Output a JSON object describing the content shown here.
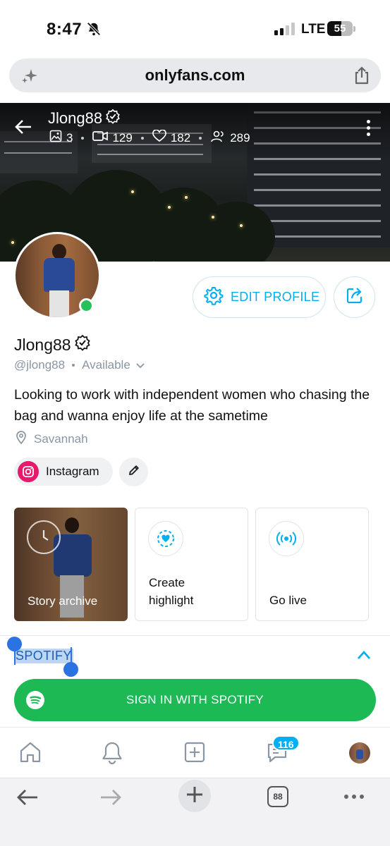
{
  "status_bar": {
    "time": "8:47",
    "network": "LTE",
    "battery": "55"
  },
  "browser": {
    "url": "onlyfans.com",
    "tabs_count": "88"
  },
  "cover": {
    "name": "Jlong88",
    "stats": {
      "photos": "3",
      "videos": "129",
      "likes": "182",
      "fans": "289"
    }
  },
  "profile": {
    "name": "Jlong88",
    "handle": "@jlong88",
    "availability": "Available",
    "bio": "Looking to work with independent women who chasing the bag and wanna enjoy life at the sametime",
    "location": "Savannah",
    "edit_label": "EDIT PROFILE",
    "online": true
  },
  "social": {
    "instagram_label": "Instagram"
  },
  "highlights": [
    {
      "label": "Story archive"
    },
    {
      "label": "Create highlight"
    },
    {
      "label": "Go live"
    }
  ],
  "spotify": {
    "section_title": "SPOTIFY",
    "button_label": "SIGN IN WITH SPOTIFY"
  },
  "app_nav": {
    "messages_badge": "116"
  },
  "colors": {
    "accent": "#00aff0",
    "spotify_green": "#1db954",
    "online_green": "#26c15b",
    "instagram_pink": "#e8196b",
    "muted_text": "#8a96a3"
  },
  "icons": [
    "sparkle-icon",
    "share-icon",
    "back-arrow-icon",
    "photo-icon",
    "video-icon",
    "heart-icon",
    "fans-icon",
    "verified-icon",
    "gear-icon",
    "edit-share-icon",
    "location-icon",
    "instagram-icon",
    "pencil-icon",
    "clock-icon",
    "heart-circle-icon",
    "broadcast-icon",
    "chevron-up-icon",
    "spotify-icon",
    "home-icon",
    "bell-icon",
    "plus-square-icon",
    "messages-icon"
  ]
}
